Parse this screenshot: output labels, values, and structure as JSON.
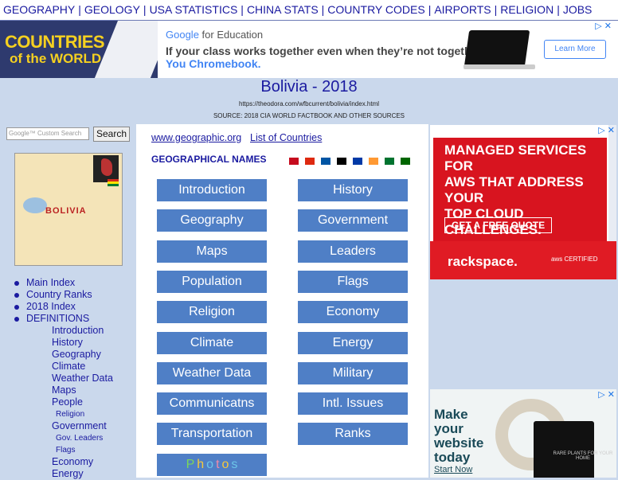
{
  "topnav": [
    "GEOGRAPHY",
    "GEOLOGY",
    "USA STATISTICS",
    "CHINA STATS",
    "COUNTRY CODES",
    "AIRPORTS",
    "RELIGION",
    "JOBS"
  ],
  "logo": {
    "line1": "COUNTRIES",
    "line2": "of the WORLD"
  },
  "ad_top": {
    "brand": "Google",
    "brand_rest": " for Education",
    "line1": "If your class works together even when they’re not together,",
    "line2": "You Chromebook.",
    "cta": "Learn More",
    "close": "▷ ✕"
  },
  "page": {
    "title": "Bolivia - 2018",
    "url": "https://theodora.com/wfbcurrent/bolivia/index.html",
    "source": "SOURCE: 2018 CIA WORLD FACTBOOK AND OTHER SOURCES"
  },
  "search": {
    "placeholder": "Google™ Custom Search",
    "button": "Search"
  },
  "map": {
    "label": "BOLIVIA"
  },
  "leftnav": [
    {
      "label": "Main Index",
      "level": 1
    },
    {
      "label": "Country Ranks",
      "level": 1
    },
    {
      "label": "2018 Index",
      "level": 1
    },
    {
      "label": "DEFINITIONS",
      "level": 1
    },
    {
      "label": "Introduction",
      "level": 2
    },
    {
      "label": "History",
      "level": 2
    },
    {
      "label": "Geography",
      "level": 2
    },
    {
      "label": "Climate",
      "level": 2
    },
    {
      "label": "Weather Data",
      "level": 2
    },
    {
      "label": "Maps",
      "level": 2
    },
    {
      "label": "People",
      "level": 2
    },
    {
      "label": "Religion",
      "level": 3
    },
    {
      "label": "Government",
      "level": 2
    },
    {
      "label": "Gov. Leaders",
      "level": 3
    },
    {
      "label": "Flags",
      "level": 3
    },
    {
      "label": "Economy",
      "level": 2
    },
    {
      "label": "Energy",
      "level": 2
    }
  ],
  "main": {
    "link1": "www.geographic.org",
    "link2": "List of Countries",
    "geonames": "GEOGRAPHICAL NAMES",
    "flag_colors": [
      "#c60b1e",
      "#de2910",
      "#0055a4",
      "#000000",
      "#0039a6",
      "#ff9933",
      "#00732f",
      "#006600"
    ],
    "buttons_left": [
      "Introduction",
      "Geography",
      "Maps",
      "Population",
      "Religion",
      "Climate",
      "Weather Data",
      "Communicatns",
      "Transportation"
    ],
    "buttons_right": [
      "History",
      "Government",
      "Leaders",
      "Flags",
      "Economy",
      "Energy",
      "Military",
      "Intl. Issues",
      "Ranks"
    ],
    "photos_letters": [
      "P",
      "h",
      "o",
      "t",
      "o",
      "s"
    ],
    "photos_colors": [
      "#7bd65a",
      "#f6c93a",
      "#6cc5e8",
      "#f08aa8",
      "#f6c93a",
      "#6cc5e8"
    ]
  },
  "ad_right": {
    "headline": [
      "MANAGED SERVICES FOR",
      "AWS THAT ADDRESS YOUR",
      "TOP CLOUD CHALLENGES."
    ],
    "cta": "GET A FREE QUOTE",
    "brand": "rackspace.",
    "badge": "aws CERTIFIED",
    "close": "▷ ✕"
  },
  "ad_bottom": {
    "lines": [
      "Make",
      "your",
      "website",
      "today"
    ],
    "cta": "Start Now",
    "device_text": "RARE PLANTS FOR YOUR HOME",
    "close": "▷ ✕"
  }
}
